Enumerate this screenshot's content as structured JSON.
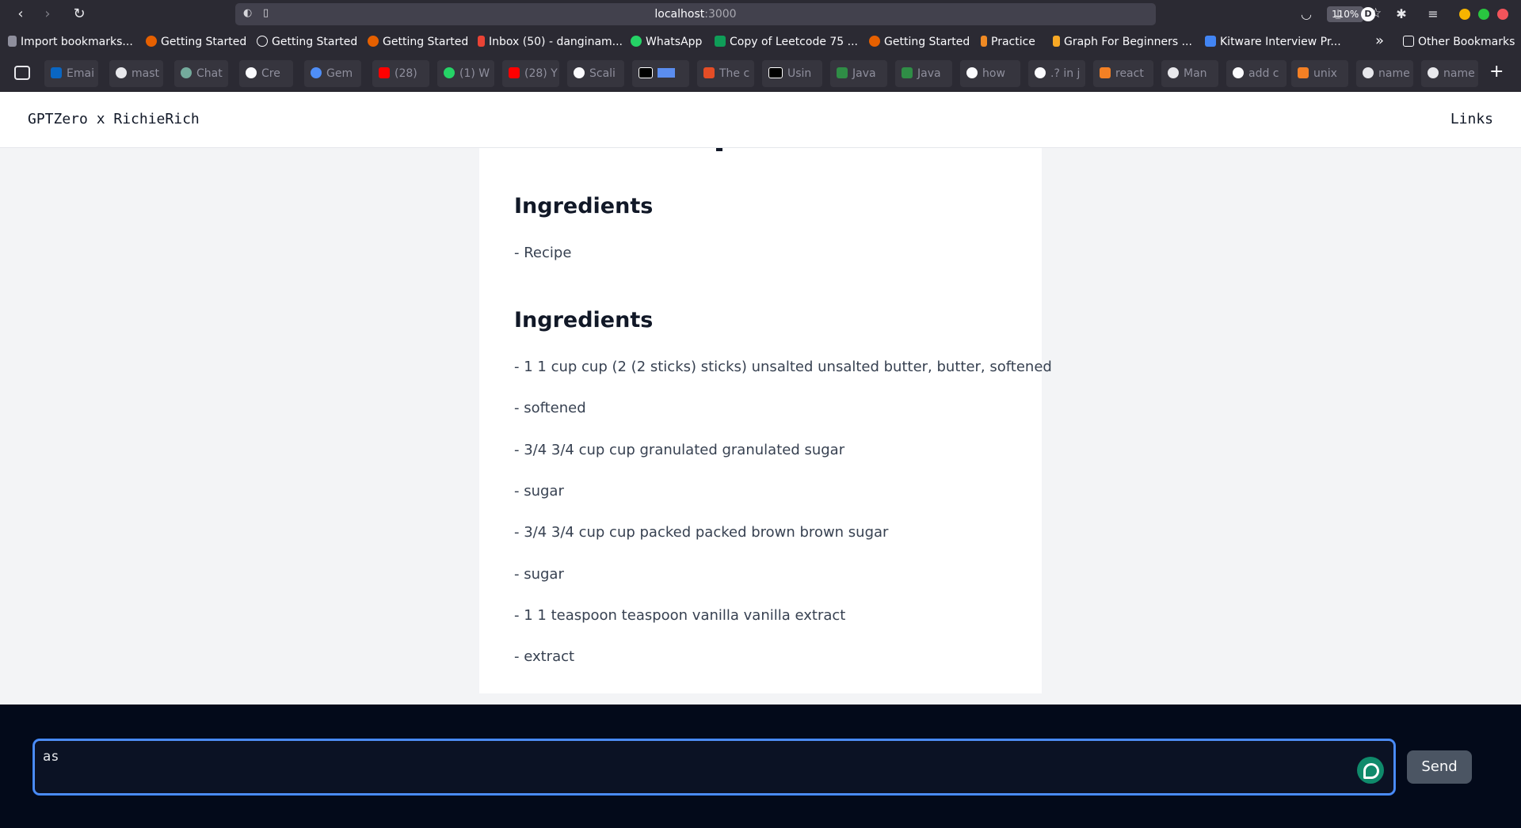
{
  "browser": {
    "url_host": "localhost",
    "url_port": ":3000",
    "zoom": "110%",
    "avatar_initial": "D",
    "bookmarks": [
      "Import bookmarks...",
      "Getting Started",
      "Getting Started",
      "Getting Started",
      "Inbox (50) - danginam...",
      "WhatsApp",
      "Copy of Leetcode 75 ...",
      "Getting Started",
      "Practice",
      "Graph For Beginners ...",
      "Kitware Interview Pr...",
      "Other Bookmarks"
    ],
    "tabs": [
      "Emai",
      "mast",
      "Chat",
      "Cre",
      "Gem",
      "(28)",
      "(1) W",
      "(28) Y",
      "Scali",
      "",
      "The c",
      "Usin",
      "Java",
      "Java",
      "how",
      ".? in j",
      "react",
      "Man",
      "add c",
      "unix",
      "name",
      "name"
    ]
  },
  "header": {
    "title": "GPTZero x RichieRich",
    "links_label": "Links"
  },
  "content": {
    "sections": [
      {
        "heading": "Ingredients",
        "items": [
          "- Recipe"
        ]
      },
      {
        "heading": "Ingredients",
        "items": [
          "- 1 1 cup cup (2 (2 sticks) sticks) unsalted unsalted butter, butter, softened",
          "- softened",
          "- 3/4 3/4 cup cup granulated granulated sugar",
          "- sugar",
          "- 3/4 3/4 cup cup packed packed brown brown sugar",
          "- sugar",
          "- 1 1 teaspoon teaspoon vanilla vanilla extract",
          "- extract"
        ]
      }
    ]
  },
  "chat": {
    "input_value": "as",
    "send_label": "Send"
  },
  "colors": {
    "chrome_bg": "#2b2a33",
    "page_bg": "#f3f4f6",
    "chat_bg": "#030a1a",
    "focus_ring": "#4f8ef7",
    "send_bg": "#4b5563"
  }
}
